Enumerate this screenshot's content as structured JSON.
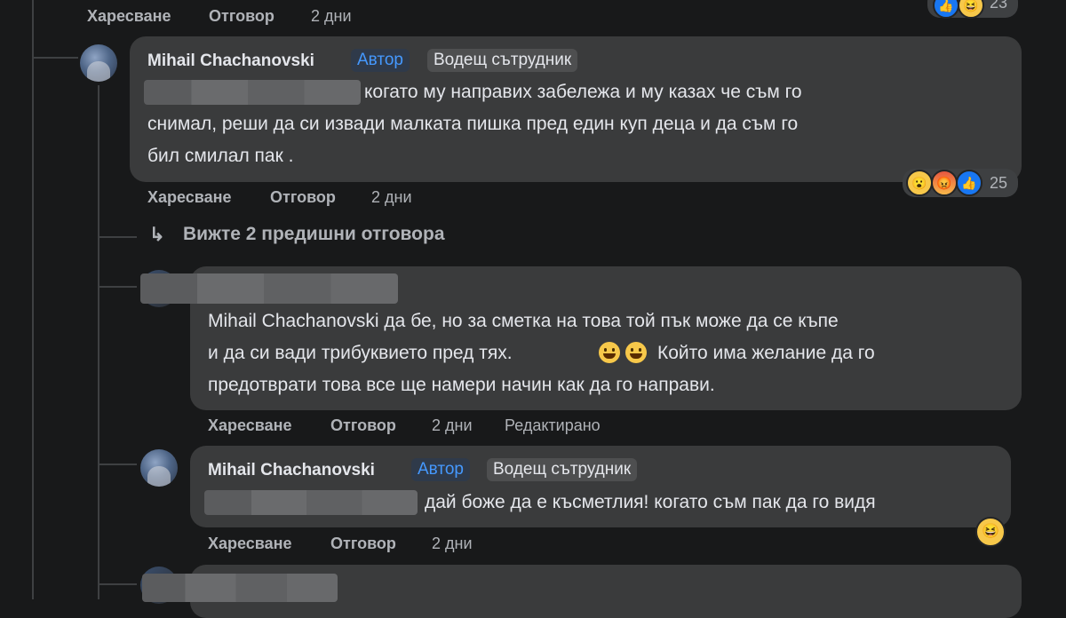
{
  "top_actions": {
    "like": "Харесване",
    "reply": "Отговор",
    "time": "2 дни",
    "reaction_count": "23"
  },
  "comment1": {
    "name": "Mihail Chachanovski",
    "badge_author": "Автор",
    "badge_contributor": "Водещ сътрудник",
    "line1": "когато му направих забележа и му казах че съм го",
    "line2": "снимал, реши да си извади малката пишка пред един куп деца и да съм го",
    "line3": "бил смилал пак .",
    "actions": {
      "like": "Харесване",
      "reply": "Отговор",
      "time": "2 дни"
    },
    "reactions": {
      "icons": [
        "wow-icon",
        "angry-icon",
        "like-icon"
      ],
      "count": "25"
    }
  },
  "view_more": {
    "arrow": "↳",
    "label": "Вижте 2 предишни отговора"
  },
  "comment2": {
    "line1": "Mihail Chachanovski да бе, но за сметка на това той пък може да се къпе",
    "line2a": "и да си вади трибуквието пред тях.",
    "line2b": "Който има желание да го",
    "line3": "предотврати това все ще намери начин как да го направи.",
    "actions": {
      "like": "Харесване",
      "reply": "Отговор",
      "time": "2 дни",
      "edited": "Редактирано"
    }
  },
  "comment3": {
    "name": "Mihail Chachanovski",
    "badge_author": "Автор",
    "badge_contributor": "Водещ сътрудник",
    "line1": "дай боже да е късметлия! когато съм пак да го видя",
    "actions": {
      "like": "Харесване",
      "reply": "Отговор",
      "time": "2 дни"
    },
    "reactions": {
      "icons": [
        "haha-icon"
      ]
    }
  }
}
